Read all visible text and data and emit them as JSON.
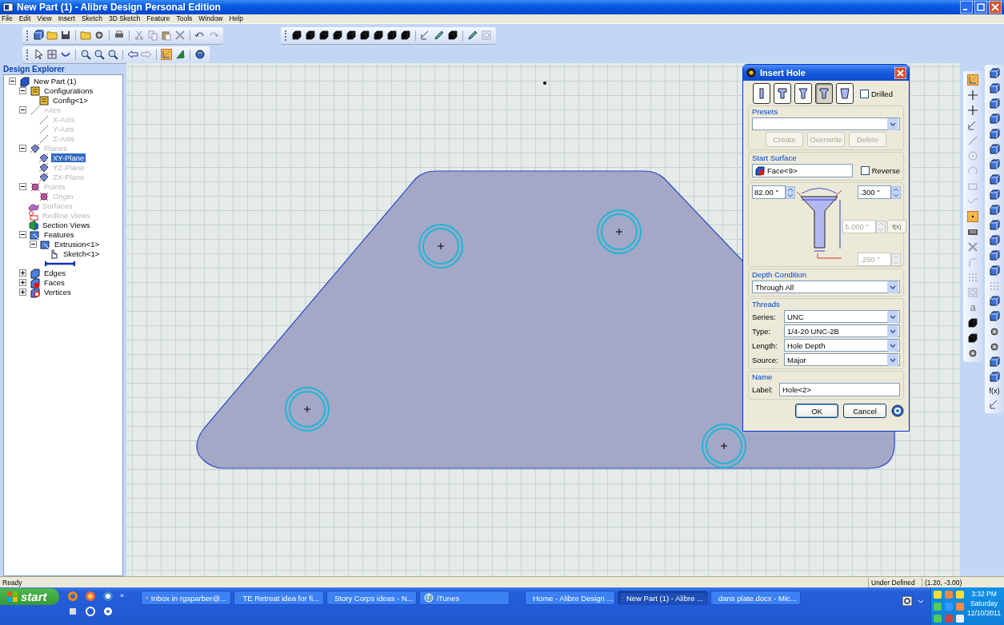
{
  "window": {
    "title": "New Part (1) - Alibre Design Personal Edition"
  },
  "menu": [
    "File",
    "Edit",
    "View",
    "Insert",
    "Sketch",
    "3D Sketch",
    "Feature",
    "Tools",
    "Window",
    "Help"
  ],
  "explorer": {
    "title": "Design Explorer",
    "tree": [
      {
        "label": "New Part (1)",
        "kind": "part",
        "expanded": true,
        "disabled": false,
        "selected": false,
        "children": [
          {
            "label": "Configurations",
            "kind": "config",
            "expanded": true,
            "disabled": false,
            "selected": false,
            "children": [
              {
                "label": "Config<1>",
                "kind": "config",
                "disabled": false,
                "selected": false
              }
            ]
          },
          {
            "label": "Axes",
            "kind": "axis",
            "expanded": true,
            "disabled": true,
            "selected": false,
            "children": [
              {
                "label": "X-Axis",
                "kind": "axis",
                "disabled": true,
                "selected": false
              },
              {
                "label": "Y-Axis",
                "kind": "axis",
                "disabled": true,
                "selected": false
              },
              {
                "label": "Z-Axis",
                "kind": "axis",
                "disabled": true,
                "selected": false
              }
            ]
          },
          {
            "label": "Planes",
            "kind": "plane",
            "expanded": true,
            "disabled": true,
            "selected": false,
            "children": [
              {
                "label": "XY-Plane",
                "kind": "plane",
                "disabled": false,
                "selected": true
              },
              {
                "label": "YZ-Plane",
                "kind": "plane",
                "disabled": true,
                "selected": false
              },
              {
                "label": "ZX-Plane",
                "kind": "plane",
                "disabled": true,
                "selected": false
              }
            ]
          },
          {
            "label": "Points",
            "kind": "point",
            "expanded": true,
            "disabled": true,
            "selected": false,
            "children": [
              {
                "label": "Origin",
                "kind": "point",
                "disabled": true,
                "selected": false
              }
            ]
          },
          {
            "label": "Surfaces",
            "kind": "surface",
            "disabled": true,
            "selected": false
          },
          {
            "label": "Redline Views",
            "kind": "redline",
            "disabled": true,
            "selected": false
          },
          {
            "label": "Section Views",
            "kind": "section",
            "disabled": false,
            "selected": false
          },
          {
            "label": "Features",
            "kind": "feature",
            "expanded": true,
            "disabled": false,
            "selected": false,
            "children": [
              {
                "label": "Extrusion<1>",
                "kind": "feature",
                "expanded": true,
                "disabled": false,
                "selected": false,
                "children": [
                  {
                    "label": "Sketch<1>",
                    "kind": "sketch",
                    "disabled": false,
                    "selected": false
                  }
                ]
              }
            ]
          },
          {
            "kind": "rollback"
          },
          {
            "label": "Edges",
            "kind": "edge",
            "expanded": false,
            "disabled": false,
            "selected": false
          },
          {
            "label": "Faces",
            "kind": "face",
            "expanded": false,
            "disabled": false,
            "selected": false
          },
          {
            "label": "Vertices",
            "kind": "vertex",
            "expanded": false,
            "disabled": false,
            "selected": false
          }
        ]
      }
    ]
  },
  "sketch_toolbar": {
    "text_tool": "a"
  },
  "feature_toolbar": {
    "function_tool": "f(x)"
  },
  "dialog": {
    "title": "Insert Hole",
    "hole_types": [
      {
        "kind": "simple",
        "selected": false
      },
      {
        "kind": "counterbore",
        "selected": false
      },
      {
        "kind": "countersink",
        "selected": false
      },
      {
        "kind": "counterdrill",
        "selected": true
      },
      {
        "kind": "tapered",
        "selected": false
      }
    ],
    "drilled": {
      "label": "Drilled",
      "checked": false
    },
    "presets": {
      "title": "Presets",
      "buttons": [
        {
          "label": "Create",
          "disabled": true
        },
        {
          "label": "Overwrite",
          "disabled": true
        },
        {
          "label": "Delete",
          "disabled": true
        }
      ]
    },
    "start_surface": {
      "title": "Start Surface",
      "value": "Face<9>",
      "reverse": {
        "label": "Reverse",
        "checked": false
      }
    },
    "dimensions": {
      "angle": {
        "value": "82.00 \"",
        "disabled": false
      },
      "head_diameter": {
        "value": ".300 \"",
        "disabled": false
      },
      "depth": {
        "value": "5.000 \"",
        "disabled": true
      },
      "diameter": {
        "value": ".250 \"",
        "disabled": true
      },
      "formula_button": "f(x)"
    },
    "depth_condition": {
      "title": "Depth Condition",
      "value": "Through All"
    },
    "threads": {
      "title": "Threads",
      "fields": [
        {
          "label": "Series:",
          "value": "UNC"
        },
        {
          "label": "Type:",
          "value": "1/4-20 UNC-2B"
        },
        {
          "label": "Length:",
          "value": "Hole Depth"
        },
        {
          "label": "Source:",
          "value": "Major"
        }
      ]
    },
    "name": {
      "title": "Name",
      "label": "Label:",
      "value": "Hole<2>"
    },
    "buttons": [
      {
        "label": "OK",
        "default": true
      },
      {
        "label": "Cancel",
        "default": false
      }
    ]
  },
  "status_bar": {
    "message": "Ready",
    "state": "Under Defined",
    "coordinates": "(1.20, -3.00)"
  },
  "taskbar": {
    "start": "start",
    "overflow": "»",
    "tasks": [
      {
        "label": "Inbox in rgsparber@...",
        "kind": "mail",
        "selected": false
      },
      {
        "label": "TE Retreat idea for fi...",
        "kind": "folder",
        "selected": false
      },
      {
        "label": "Story Corps ideas - N...",
        "kind": "folder",
        "selected": false
      },
      {
        "label": "iTunes",
        "kind": "music",
        "selected": false
      },
      {
        "label": "Home - Alibre Design ...",
        "kind": "app",
        "selected": false
      },
      {
        "label": "New Part (1) - Alibre ...",
        "kind": "part",
        "selected": true
      },
      {
        "label": "dans plate.docx - Mic...",
        "kind": "document",
        "selected": false
      }
    ],
    "clock": {
      "time": "3:32 PM",
      "day": "Saturday",
      "date": "12/10/2011"
    }
  }
}
